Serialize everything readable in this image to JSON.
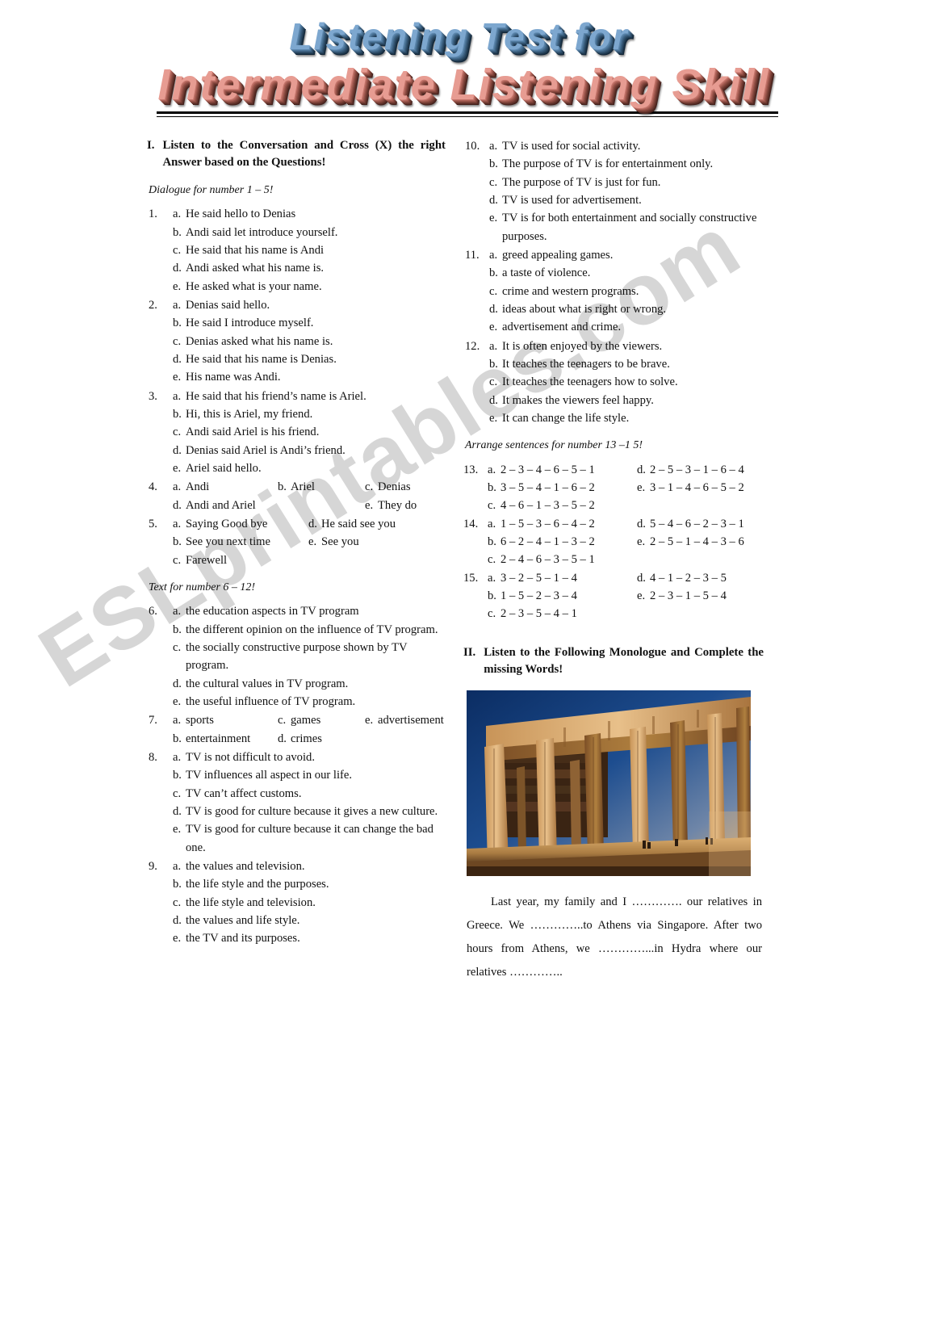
{
  "title": {
    "line1": "Listening Test for",
    "line2": "Intermediate Listening Skill",
    "line1_color": "#7da7cf",
    "line2_color": "#e79c92"
  },
  "watermark": {
    "text": "ESLprintables.com"
  },
  "section_i": {
    "number": "I.",
    "heading": "Listen to the Conversation and Cross (X) the right Answer based on the Questions!",
    "dialogue_instruction": "Dialogue for number 1 – 5!",
    "text_instruction": "Text for number 6 – 12!"
  },
  "section_ii": {
    "number": "II.",
    "heading": "Listen to the Following Monologue and Complete the missing Words!",
    "arrange_instruction": "Arrange sentences for number 13 –1 5!"
  },
  "questions": [
    {
      "number": "1.",
      "layout": "stacked",
      "options": [
        {
          "letter": "a.",
          "text": "He said hello to Denias"
        },
        {
          "letter": "b.",
          "text": "Andi said let introduce yourself."
        },
        {
          "letter": "c.",
          "text": "He said that his name is Andi"
        },
        {
          "letter": "d.",
          "text": "Andi asked what his name is."
        },
        {
          "letter": "e.",
          "text": "He asked what is your name."
        }
      ]
    },
    {
      "number": "2.",
      "layout": "stacked",
      "options": [
        {
          "letter": "a.",
          "text": "Denias said hello."
        },
        {
          "letter": "b.",
          "text": "He said I introduce myself."
        },
        {
          "letter": "c.",
          "text": "Denias asked what his name is."
        },
        {
          "letter": "d.",
          "text": "He said that his name is Denias."
        },
        {
          "letter": "e.",
          "text": "His name was Andi."
        }
      ]
    },
    {
      "number": "3.",
      "layout": "stacked",
      "options": [
        {
          "letter": "a.",
          "text": "He said that his friend’s name is Ariel."
        },
        {
          "letter": "b.",
          "text": "Hi, this is Ariel, my friend."
        },
        {
          "letter": "c.",
          "text": "Andi said Ariel is his friend."
        },
        {
          "letter": "d.",
          "text": "Denias said Ariel is Andi’s friend."
        },
        {
          "letter": "e.",
          "text": "Ariel said hello."
        }
      ]
    },
    {
      "number": "4.",
      "layout": "grid3",
      "rows": [
        [
          {
            "letter": "a.",
            "text": "Andi"
          },
          {
            "letter": "b.",
            "text": "Ariel"
          },
          {
            "letter": "c.",
            "text": "Denias"
          }
        ],
        [
          {
            "letter": "d.",
            "text": "Andi and Ariel"
          },
          {
            "letter": "",
            "text": ""
          },
          {
            "letter": "e.",
            "text": "They do"
          }
        ]
      ]
    },
    {
      "number": "5.",
      "layout": "grid2",
      "rows": [
        [
          {
            "letter": "a.",
            "text": "Saying Good bye"
          },
          {
            "letter": "d.",
            "text": "He said see you"
          }
        ],
        [
          {
            "letter": "b.",
            "text": "See you next time"
          },
          {
            "letter": "e.",
            "text": "See you"
          }
        ],
        [
          {
            "letter": "c.",
            "text": "Farewell"
          },
          {
            "letter": "",
            "text": ""
          }
        ]
      ]
    },
    {
      "number": "6.",
      "layout": "stacked",
      "options": [
        {
          "letter": "a.",
          "text": "the education aspects in TV program"
        },
        {
          "letter": "b.",
          "text": "the different opinion on the influence of TV program."
        },
        {
          "letter": "c.",
          "text": "the socially constructive purpose shown by TV program."
        },
        {
          "letter": "d.",
          "text": "the cultural values in TV program."
        },
        {
          "letter": "e.",
          "text": "the useful influence of TV program."
        }
      ]
    },
    {
      "number": "7.",
      "layout": "grid3",
      "rows": [
        [
          {
            "letter": "a.",
            "text": "sports"
          },
          {
            "letter": "c.",
            "text": "games"
          },
          {
            "letter": "e.",
            "text": "advertisement"
          }
        ],
        [
          {
            "letter": "b.",
            "text": "entertainment"
          },
          {
            "letter": "d.",
            "text": "crimes"
          },
          {
            "letter": "",
            "text": ""
          }
        ]
      ]
    },
    {
      "number": "8.",
      "layout": "stacked",
      "options": [
        {
          "letter": "a.",
          "text": "TV is not difficult to avoid."
        },
        {
          "letter": "b.",
          "text": "TV influences all aspect in our life."
        },
        {
          "letter": "c.",
          "text": "TV can’t affect customs."
        },
        {
          "letter": "d.",
          "text": "TV is good for culture because it gives a new culture."
        },
        {
          "letter": "e.",
          "text": "TV is good for culture because it can change the bad one."
        }
      ]
    },
    {
      "number": "9.",
      "layout": "stacked",
      "options": [
        {
          "letter": "a.",
          "text": "the values and television."
        },
        {
          "letter": "b.",
          "text": "the life style and the purposes."
        },
        {
          "letter": "c.",
          "text": "the life style and television."
        },
        {
          "letter": "d.",
          "text": "the values and life style."
        },
        {
          "letter": "e.",
          "text": "the TV and its purposes."
        }
      ]
    },
    {
      "number": "10.",
      "layout": "stacked",
      "options": [
        {
          "letter": "a.",
          "text": "TV is used for social activity."
        },
        {
          "letter": "b.",
          "text": "The purpose of TV is for entertainment only."
        },
        {
          "letter": "c.",
          "text": "The purpose of TV is just for fun."
        },
        {
          "letter": "d.",
          "text": "TV is used for advertisement."
        },
        {
          "letter": "e.",
          "text": "TV is for both entertainment and socially constructive purposes."
        }
      ]
    },
    {
      "number": "11.",
      "layout": "stacked",
      "options": [
        {
          "letter": "a.",
          "text": "greed appealing games."
        },
        {
          "letter": "b.",
          "text": "a taste of violence."
        },
        {
          "letter": "c.",
          "text": "crime and western programs."
        },
        {
          "letter": "d.",
          "text": "ideas about what is right or wrong."
        },
        {
          "letter": "e.",
          "text": "advertisement and crime."
        }
      ]
    },
    {
      "number": "12.",
      "layout": "stacked",
      "options": [
        {
          "letter": "a.",
          "text": "It is often enjoyed by the viewers."
        },
        {
          "letter": "b.",
          "text": "It teaches the teenagers to be brave."
        },
        {
          "letter": "c.",
          "text": "It teaches the teenagers how to solve."
        },
        {
          "letter": "d.",
          "text": "It makes the viewers feel happy."
        },
        {
          "letter": "e.",
          "text": "It can change the life style."
        }
      ]
    }
  ],
  "arrange_questions": [
    {
      "number": "13.",
      "rows": [
        [
          {
            "letter": "a.",
            "text": "2 – 3 – 4 – 6 – 5 – 1"
          },
          {
            "letter": "d.",
            "text": "2 – 5 – 3 – 1 – 6 – 4"
          }
        ],
        [
          {
            "letter": "b.",
            "text": "3 – 5 – 4 – 1 – 6 – 2"
          },
          {
            "letter": "e.",
            "text": "3 – 1 – 4 – 6 – 5 – 2"
          }
        ],
        [
          {
            "letter": "c.",
            "text": "4 – 6 – 1 – 3 – 5 – 2"
          },
          {
            "letter": "",
            "text": ""
          }
        ]
      ]
    },
    {
      "number": "14.",
      "rows": [
        [
          {
            "letter": "a.",
            "text": "1 – 5 – 3 – 6 – 4 – 2"
          },
          {
            "letter": "d.",
            "text": "5 – 4 – 6 – 2 – 3 – 1"
          }
        ],
        [
          {
            "letter": "b.",
            "text": "6 – 2 – 4 – 1 – 3 – 2"
          },
          {
            "letter": "e.",
            "text": "2 – 5 – 1 – 4 – 3 – 6"
          }
        ],
        [
          {
            "letter": "c.",
            "text": "2 – 4 – 6 – 3 – 5 – 1"
          },
          {
            "letter": "",
            "text": ""
          }
        ]
      ]
    },
    {
      "number": "15.",
      "rows": [
        [
          {
            "letter": "a.",
            "text": "3 – 2 – 5 – 1 – 4"
          },
          {
            "letter": "d.",
            "text": "4 – 1 – 2 – 3 – 5"
          }
        ],
        [
          {
            "letter": "b.",
            "text": "1 – 5 – 2 – 3 – 4"
          },
          {
            "letter": "e.",
            "text": "2 – 3 – 1 – 5 – 4"
          }
        ],
        [
          {
            "letter": "c.",
            "text": "2 – 3 – 5 – 4 – 1"
          },
          {
            "letter": "",
            "text": ""
          }
        ]
      ]
    }
  ],
  "photo": {
    "caption": "Parthenon temple columns at sunset, Athens Greece"
  },
  "passage": {
    "text": "Last year, my family and I …………. our relatives in Greece. We …………..to Athens via Singapore. After two hours from Athens, we …………...in Hydra where our relatives ………….."
  }
}
